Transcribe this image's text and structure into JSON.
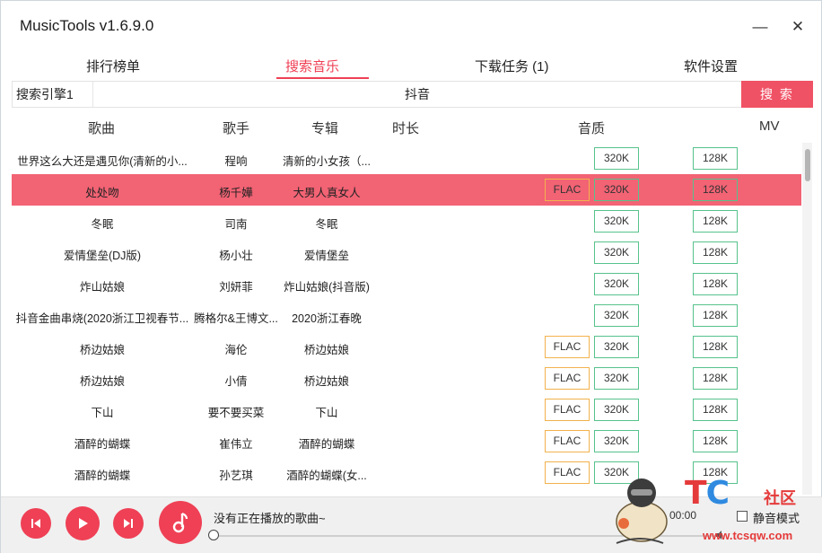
{
  "app": {
    "title": "MusicTools v1.6.9.0"
  },
  "window_controls": {
    "minimize": "—",
    "close": "✕"
  },
  "tabs": [
    {
      "label": "排行榜单",
      "active": false
    },
    {
      "label": "搜索音乐",
      "active": true
    },
    {
      "label": "下载任务 (1)",
      "active": false
    },
    {
      "label": "软件设置",
      "active": false
    }
  ],
  "search": {
    "engine_label": "搜索引擎1",
    "query": "抖音",
    "button_label": "搜 索"
  },
  "columns": {
    "song": "歌曲",
    "singer": "歌手",
    "album": "专辑",
    "duration": "时长",
    "quality": "音质",
    "mv": "MV"
  },
  "rows": [
    {
      "song": "世界这么大还是遇见你(清新的小...",
      "singer": "程响",
      "album": "清新的小女孩（...",
      "flac": "",
      "q320": "320K",
      "q128": "128K"
    },
    {
      "song": "处处吻",
      "singer": "杨千嬅",
      "album": "大男人真女人",
      "flac": "FLAC",
      "q320": "320K",
      "q128": "128K",
      "selected": true
    },
    {
      "song": "冬眠",
      "singer": "司南",
      "album": "冬眠",
      "flac": "",
      "q320": "320K",
      "q128": "128K"
    },
    {
      "song": "爱情堡垒(DJ版)",
      "singer": "杨小壮",
      "album": "爱情堡垒",
      "flac": "",
      "q320": "320K",
      "q128": "128K"
    },
    {
      "song": "炸山姑娘",
      "singer": "刘妍菲",
      "album": "炸山姑娘(抖音版)",
      "flac": "",
      "q320": "320K",
      "q128": "128K"
    },
    {
      "song": "抖音金曲串烧(2020浙江卫视春节...",
      "singer": "腾格尔&王博文...",
      "album": "2020浙江春晚",
      "flac": "",
      "q320": "320K",
      "q128": "128K"
    },
    {
      "song": "桥边姑娘",
      "singer": "海伦",
      "album": "桥边姑娘",
      "flac": "FLAC",
      "q320": "320K",
      "q128": "128K"
    },
    {
      "song": "桥边姑娘",
      "singer": "小倩",
      "album": "桥边姑娘",
      "flac": "FLAC",
      "q320": "320K",
      "q128": "128K"
    },
    {
      "song": "下山",
      "singer": "要不要买菜",
      "album": "下山",
      "flac": "FLAC",
      "q320": "320K",
      "q128": "128K"
    },
    {
      "song": "酒醉的蝴蝶",
      "singer": "崔伟立",
      "album": "酒醉的蝴蝶",
      "flac": "FLAC",
      "q320": "320K",
      "q128": "128K"
    },
    {
      "song": "酒醉的蝴蝶",
      "singer": "孙艺琪",
      "album": "酒醉的蝴蝶(女...",
      "flac": "FLAC",
      "q320": "320K",
      "q128": "128K"
    }
  ],
  "player": {
    "now_playing": "没有正在播放的歌曲~",
    "time": "00:00",
    "silent_mode_label": "静音模式",
    "silent_mode_checked": false
  },
  "watermark": {
    "brand_t": "T",
    "brand_c": "C",
    "brand_she": "社区",
    "url": "www.tcsqw.com"
  },
  "colors": {
    "accent": "#ef4055",
    "selected_row": "#f26374",
    "flac_border": "#f2b24d",
    "mp3_border": "#57c28c"
  }
}
